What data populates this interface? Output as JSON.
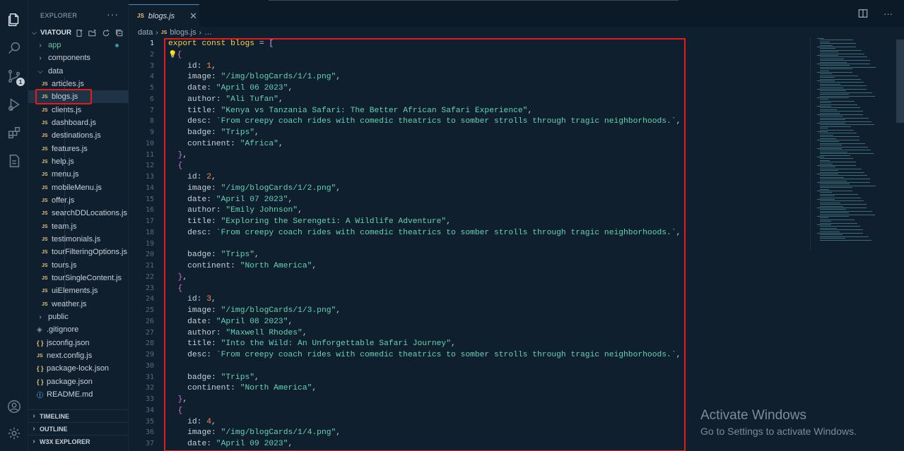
{
  "explorer": {
    "title": "EXPLORER",
    "more": "···",
    "project": "VIATOUR",
    "items": [
      {
        "label": "app",
        "type": "folder",
        "open": false
      },
      {
        "label": "components",
        "type": "folder",
        "open": false
      },
      {
        "label": "data",
        "type": "folder",
        "open": true
      },
      {
        "label": "articles.js",
        "type": "js"
      },
      {
        "label": "blogs.js",
        "type": "js"
      },
      {
        "label": "clients.js",
        "type": "js"
      },
      {
        "label": "dashboard.js",
        "type": "js"
      },
      {
        "label": "destinations.js",
        "type": "js"
      },
      {
        "label": "features.js",
        "type": "js"
      },
      {
        "label": "help.js",
        "type": "js"
      },
      {
        "label": "menu.js",
        "type": "js"
      },
      {
        "label": "mobileMenu.js",
        "type": "js"
      },
      {
        "label": "offer.js",
        "type": "js"
      },
      {
        "label": "searchDDLocations.js",
        "type": "js"
      },
      {
        "label": "team.js",
        "type": "js"
      },
      {
        "label": "testimonials.js",
        "type": "js"
      },
      {
        "label": "tourFilteringOptions.js",
        "type": "js"
      },
      {
        "label": "tours.js",
        "type": "js"
      },
      {
        "label": "tourSingleContent.js",
        "type": "js"
      },
      {
        "label": "uiElements.js",
        "type": "js"
      },
      {
        "label": "weather.js",
        "type": "js"
      },
      {
        "label": "public",
        "type": "folder",
        "open": false
      },
      {
        "label": ".gitignore",
        "type": "git"
      },
      {
        "label": "jsconfig.json",
        "type": "json"
      },
      {
        "label": "next.config.js",
        "type": "js"
      },
      {
        "label": "package-lock.json",
        "type": "json"
      },
      {
        "label": "package.json",
        "type": "json"
      },
      {
        "label": "README.md",
        "type": "info"
      }
    ],
    "sections": [
      "TIMELINE",
      "OUTLINE",
      "W3X EXPLORER"
    ]
  },
  "tab": {
    "icon": "JS",
    "name": "blogs.js",
    "close": "✕"
  },
  "breadcrumb": {
    "folder": "data",
    "icon": "JS",
    "file": "blogs.js",
    "more": "…"
  },
  "icons": {
    "js": "JS",
    "json": "{ }",
    "git": "◈",
    "info": "ⓘ",
    "bulb": "💡"
  },
  "code": {
    "lines": [
      [
        [
          "kw",
          "export"
        ],
        [
          "op",
          " "
        ],
        [
          "kw",
          "const"
        ],
        [
          "op",
          " "
        ],
        [
          "id",
          "blogs"
        ],
        [
          "op",
          " = "
        ],
        [
          "br",
          "["
        ]
      ],
      [
        [
          "bulb",
          "💡"
        ],
        [
          "br2",
          "{"
        ]
      ],
      [
        [
          "prop",
          "    id: "
        ],
        [
          "num",
          "1"
        ],
        [
          "op",
          ","
        ]
      ],
      [
        [
          "prop",
          "    image: "
        ],
        [
          "str",
          "\"/img/blogCards/1/1.png\""
        ],
        [
          "op",
          ","
        ]
      ],
      [
        [
          "prop",
          "    date: "
        ],
        [
          "str",
          "\"April 06 2023\""
        ],
        [
          "op",
          ","
        ]
      ],
      [
        [
          "prop",
          "    author: "
        ],
        [
          "str",
          "\"Ali Tufan\""
        ],
        [
          "op",
          ","
        ]
      ],
      [
        [
          "prop",
          "    title: "
        ],
        [
          "str",
          "\"Kenya vs Tanzania Safari: The Better African Safari Experience\""
        ],
        [
          "op",
          ","
        ]
      ],
      [
        [
          "prop",
          "    desc: "
        ],
        [
          "str",
          "`From creepy coach rides with comedic theatrics to somber strolls through tragic neighborhoods.`"
        ],
        [
          "op",
          ","
        ]
      ],
      [
        [
          "prop",
          "    badge: "
        ],
        [
          "str",
          "\"Trips\""
        ],
        [
          "op",
          ","
        ]
      ],
      [
        [
          "prop",
          "    continent: "
        ],
        [
          "str",
          "\"Africa\""
        ],
        [
          "op",
          ","
        ]
      ],
      [
        [
          "br2",
          "  }"
        ],
        [
          "op",
          ","
        ]
      ],
      [
        [
          "br2",
          "  {"
        ]
      ],
      [
        [
          "prop",
          "    id: "
        ],
        [
          "num",
          "2"
        ],
        [
          "op",
          ","
        ]
      ],
      [
        [
          "prop",
          "    image: "
        ],
        [
          "str",
          "\"/img/blogCards/1/2.png\""
        ],
        [
          "op",
          ","
        ]
      ],
      [
        [
          "prop",
          "    date: "
        ],
        [
          "str",
          "\"April 07 2023\""
        ],
        [
          "op",
          ","
        ]
      ],
      [
        [
          "prop",
          "    author: "
        ],
        [
          "str",
          "\"Emily Johnson\""
        ],
        [
          "op",
          ","
        ]
      ],
      [
        [
          "prop",
          "    title: "
        ],
        [
          "str",
          "\"Exploring the Serengeti: A Wildlife Adventure\""
        ],
        [
          "op",
          ","
        ]
      ],
      [
        [
          "prop",
          "    desc: "
        ],
        [
          "str",
          "`From creepy coach rides with comedic theatrics to somber strolls through tragic neighborhoods.`"
        ],
        [
          "op",
          ","
        ]
      ],
      [
        [
          "op",
          ""
        ]
      ],
      [
        [
          "prop",
          "    badge: "
        ],
        [
          "str",
          "\"Trips\""
        ],
        [
          "op",
          ","
        ]
      ],
      [
        [
          "prop",
          "    continent: "
        ],
        [
          "str",
          "\"North America\""
        ],
        [
          "op",
          ","
        ]
      ],
      [
        [
          "br2",
          "  }"
        ],
        [
          "op",
          ","
        ]
      ],
      [
        [
          "br2",
          "  {"
        ]
      ],
      [
        [
          "prop",
          "    id: "
        ],
        [
          "num",
          "3"
        ],
        [
          "op",
          ","
        ]
      ],
      [
        [
          "prop",
          "    image: "
        ],
        [
          "str",
          "\"/img/blogCards/1/3.png\""
        ],
        [
          "op",
          ","
        ]
      ],
      [
        [
          "prop",
          "    date: "
        ],
        [
          "str",
          "\"April 08 2023\""
        ],
        [
          "op",
          ","
        ]
      ],
      [
        [
          "prop",
          "    author: "
        ],
        [
          "str",
          "\"Maxwell Rhodes\""
        ],
        [
          "op",
          ","
        ]
      ],
      [
        [
          "prop",
          "    title: "
        ],
        [
          "str",
          "\"Into the Wild: An Unforgettable Safari Journey\""
        ],
        [
          "op",
          ","
        ]
      ],
      [
        [
          "prop",
          "    desc: "
        ],
        [
          "str",
          "`From creepy coach rides with comedic theatrics to somber strolls through tragic neighborhoods.`"
        ],
        [
          "op",
          ","
        ]
      ],
      [
        [
          "op",
          ""
        ]
      ],
      [
        [
          "prop",
          "    badge: "
        ],
        [
          "str",
          "\"Trips\""
        ],
        [
          "op",
          ","
        ]
      ],
      [
        [
          "prop",
          "    continent: "
        ],
        [
          "str",
          "\"North America\""
        ],
        [
          "op",
          ","
        ]
      ],
      [
        [
          "br2",
          "  }"
        ],
        [
          "op",
          ","
        ]
      ],
      [
        [
          "br2",
          "  {"
        ]
      ],
      [
        [
          "prop",
          "    id: "
        ],
        [
          "num",
          "4"
        ],
        [
          "op",
          ","
        ]
      ],
      [
        [
          "prop",
          "    image: "
        ],
        [
          "str",
          "\"/img/blogCards/1/4.png\""
        ],
        [
          "op",
          ","
        ]
      ],
      [
        [
          "prop",
          "    date: "
        ],
        [
          "str",
          "\"April 09 2023\""
        ],
        [
          "op",
          ","
        ]
      ]
    ]
  },
  "watermark": {
    "title": "Activate Windows",
    "subtitle": "Go to Settings to activate Windows."
  }
}
